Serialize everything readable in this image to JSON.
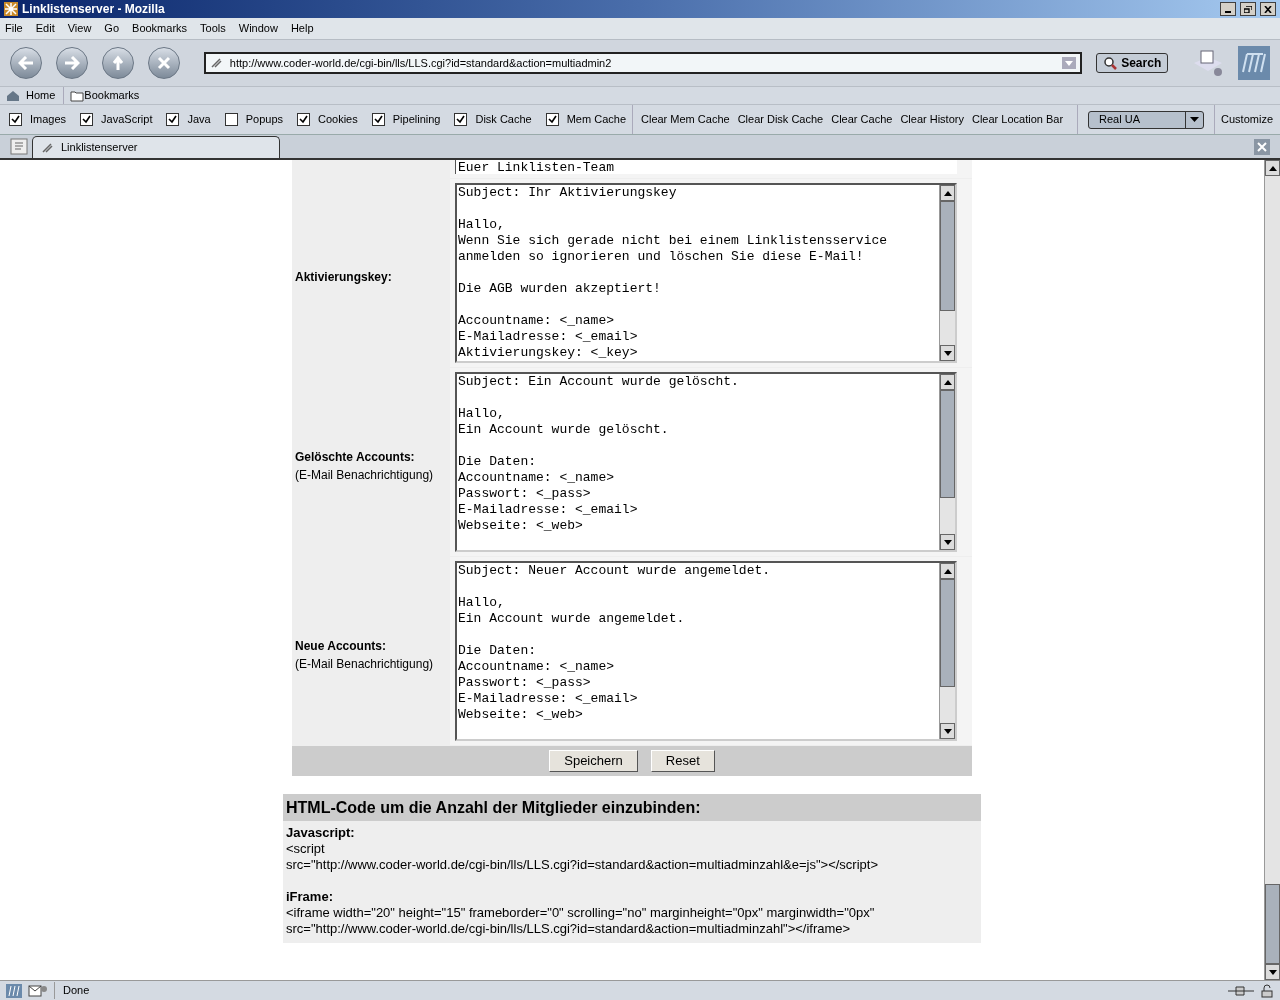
{
  "window": {
    "title": "Linklistenserver - Mozilla"
  },
  "menu": [
    "File",
    "Edit",
    "View",
    "Go",
    "Bookmarks",
    "Tools",
    "Window",
    "Help"
  ],
  "address": {
    "value": "http://www.coder-world.de/cgi-bin/lls/LLS.cgi?id=standard&action=multiadmin2"
  },
  "search_button": "Search",
  "personal_toolbar": [
    "Home",
    "Bookmarks"
  ],
  "prefbar": {
    "checkboxes": [
      {
        "label": "Images",
        "checked": true
      },
      {
        "label": "JavaScript",
        "checked": true
      },
      {
        "label": "Java",
        "checked": true
      },
      {
        "label": "Popups",
        "checked": false
      },
      {
        "label": "Cookies",
        "checked": true
      },
      {
        "label": "Pipelining",
        "checked": true
      },
      {
        "label": "Disk Cache",
        "checked": true
      },
      {
        "label": "Mem Cache",
        "checked": true
      }
    ],
    "buttons": [
      "Clear Mem Cache",
      "Clear Disk Cache",
      "Clear Cache",
      "Clear History",
      "Clear Location Bar"
    ],
    "ua_select": "Real UA",
    "customize": "Customize"
  },
  "tabs": [
    {
      "label": "Linklistenserver",
      "selected": true
    }
  ],
  "form": {
    "top_fragment": "Euer Linklisten-Team",
    "rows": [
      {
        "label": "Aktivierungskey:",
        "note": "",
        "text": "Subject: Ihr Aktivierungskey\n\nHallo,\nWenn Sie sich gerade nicht bei einem Linklistensservice\nanmelden so ignorieren und löschen Sie diese E-Mail!\n\nDie AGB wurden akzeptiert!\n\nAccountname: <_name>\nE-Mailadresse: <_email>\nAktivierungskey: <_key>"
      },
      {
        "label": "Gelöschte Accounts:",
        "note": "(E-Mail Benachrichtigung)",
        "text": "Subject: Ein Account wurde gelöscht.\n\nHallo,\nEin Account wurde gelöscht.\n\nDie Daten:\nAccountname: <_name>\nPasswort: <_pass>\nE-Mailadresse: <_email>\nWebseite: <_web>"
      },
      {
        "label": "Neue Accounts:",
        "note": "(E-Mail Benachrichtigung)",
        "text": "Subject: Neuer Account wurde angemeldet.\n\nHallo,\nEin Account wurde angemeldet.\n\nDie Daten:\nAccountname: <_name>\nPasswort: <_pass>\nE-Mailadresse: <_email>\nWebseite: <_web>"
      }
    ],
    "buttons": [
      "Speichern",
      "Reset"
    ]
  },
  "code_section": {
    "title": "HTML-Code um die Anzahl der Mitglieder einzubinden:",
    "blocks": [
      {
        "heading": "Javascript:",
        "lines": [
          "<script",
          "src=\"http://www.coder-world.de/cgi-bin/lls/LLS.cgi?id=standard&action=multiadminzahl&e=js\"></script>"
        ]
      },
      {
        "heading": "iFrame:",
        "lines": [
          "<iframe width=\"20\" height=\"15\" frameborder=\"0\" scrolling=\"no\" marginheight=\"0px\" marginwidth=\"0px\"",
          "src=\"http://www.coder-world.de/cgi-bin/lls/LLS.cgi?id=standard&action=multiadminzahl\"></iframe>"
        ]
      }
    ]
  },
  "status_bar": {
    "text": "Done"
  }
}
